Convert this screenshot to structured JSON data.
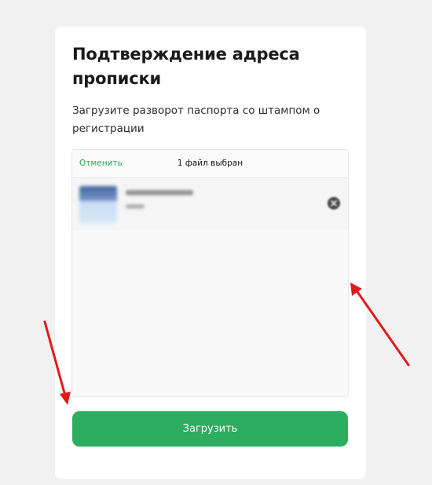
{
  "card": {
    "title": "Подтверждение адреса прописки",
    "subtitle": "Загрузите разворот паспорта со штампом о регистрации"
  },
  "uploader": {
    "cancel_label": "Отменить",
    "status_text": "1 файл выбран",
    "file": {
      "thumbnail_icon": "image-thumbnail-icon",
      "remove_icon": "remove-file-icon"
    }
  },
  "upload_button_label": "Загрузить",
  "colors": {
    "accent": "#2dad5f",
    "link": "#2aa853",
    "annotation": "#e01b1b"
  }
}
